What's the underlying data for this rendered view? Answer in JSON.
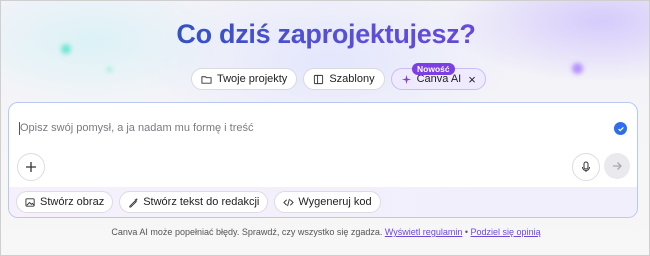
{
  "heading": "Co dziś zaprojektujesz?",
  "tabs": [
    {
      "label": "Twoje projekty",
      "icon": "folder-icon"
    },
    {
      "label": "Szablony",
      "icon": "template-icon"
    },
    {
      "label": "Canva AI",
      "icon": "sparkle-icon",
      "close": "×"
    }
  ],
  "badge": "Nowość",
  "prompt": {
    "placeholder": "Opisz swój pomysł, a ja nadam mu formę i treść"
  },
  "actions": [
    {
      "label": "Stwórz obraz",
      "icon": "image-add-icon"
    },
    {
      "label": "Stwórz tekst do redakcji",
      "icon": "pen-sparkle-icon"
    },
    {
      "label": "Wygeneruj kod",
      "icon": "code-icon"
    }
  ],
  "footer": {
    "text": "Canva AI może popełniać błędy. Sprawdź, czy wszystko się zgadza.",
    "link1": "Wyświetl regulamin",
    "sep": "•",
    "link2": "Podziel się opinią"
  },
  "colors": {
    "accent": "#7b3fe4",
    "check": "#2f6df0",
    "border": "#b9c8f3"
  }
}
